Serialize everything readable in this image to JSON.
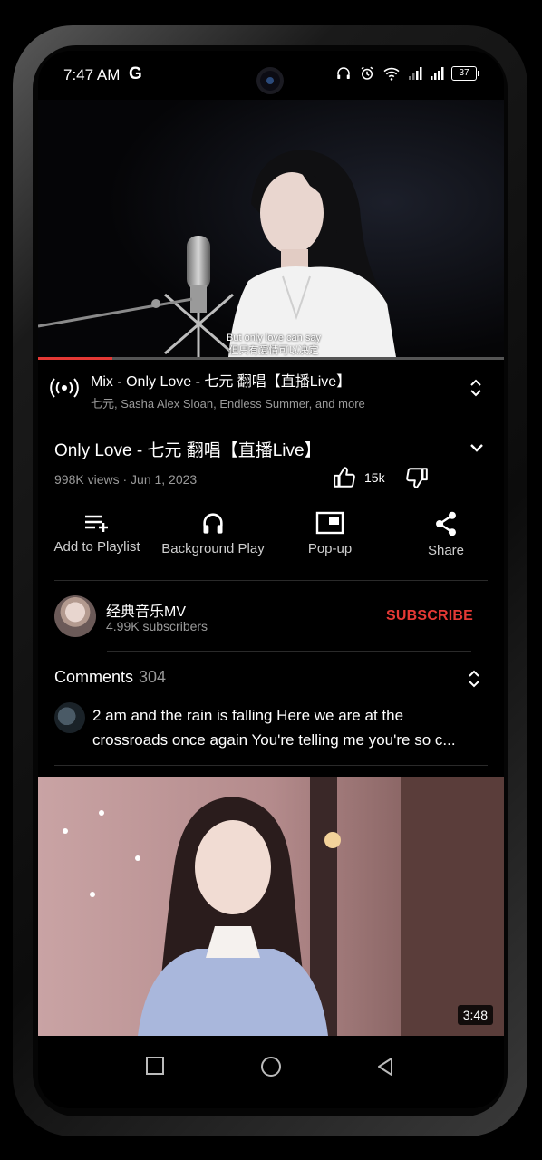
{
  "status_bar": {
    "time": "7:47 AM",
    "carrier_icon": "G",
    "battery": "37",
    "icons": [
      "headphones-icon",
      "alarm-icon",
      "wifi-icon",
      "signal-icon",
      "signal-icon",
      "battery-icon"
    ]
  },
  "player": {
    "subtitle_en": "But only love can say",
    "subtitle_zh": "但只有爱情可以决定",
    "progress": 0.16
  },
  "mix": {
    "title": "Mix - Only Love - 七元 翻唱【直播Live】",
    "subtitle": "七元, Sasha Alex Sloan, Endless Summer, and more"
  },
  "video": {
    "title": "Only Love - 七元 翻唱【直播Live】",
    "meta": "998K views · Jun 1, 2023",
    "likes": "15k"
  },
  "actions": [
    {
      "label": "Add to Playlist",
      "icon": "playlist-add-icon"
    },
    {
      "label": "Background Play",
      "icon": "headphones-icon"
    },
    {
      "label": "Pop-up",
      "icon": "popup-icon"
    },
    {
      "label": "Share",
      "icon": "share-icon"
    }
  ],
  "channel": {
    "name": "经典音乐MV",
    "subscribers": "4.99K subscribers",
    "subscribe_label": "SUBSCRIBE"
  },
  "comments": {
    "header": "Comments",
    "count": "304",
    "top_comment_line1": "2 am and the rain is falling Here we are at the",
    "top_comment_line2": "crossroads once again You're telling me you're so c..."
  },
  "next_video": {
    "duration": "3:48"
  },
  "colors": {
    "accent": "#e53935",
    "secondary_text": "#9a9a9a",
    "background": "#000000"
  }
}
